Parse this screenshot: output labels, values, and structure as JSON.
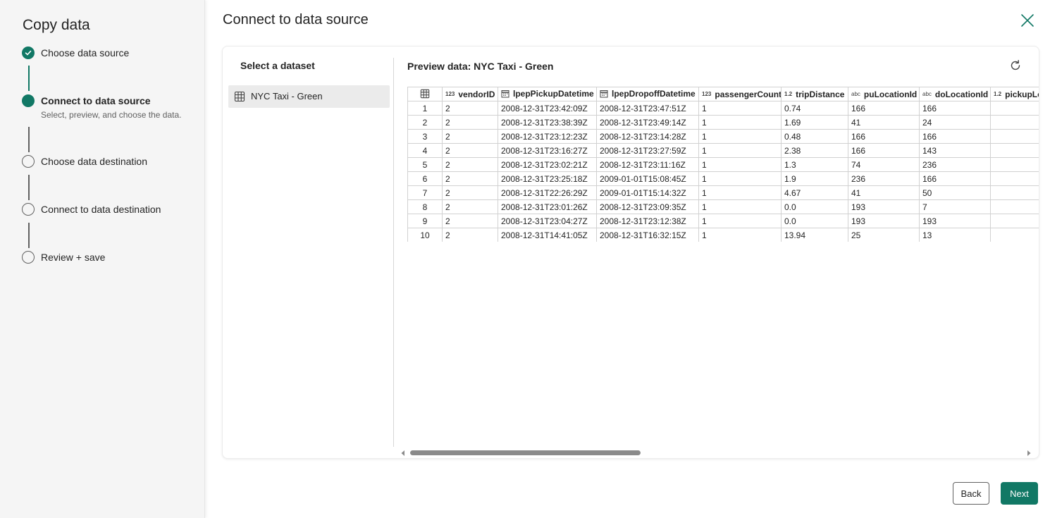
{
  "wizard": {
    "title": "Copy data",
    "steps": [
      {
        "label": "Choose data source",
        "sublabel": "",
        "state": "done"
      },
      {
        "label": "Connect to data source",
        "sublabel": "Select, preview, and choose the data.",
        "state": "current"
      },
      {
        "label": "Choose data destination",
        "sublabel": "",
        "state": "pending"
      },
      {
        "label": "Connect to data destination",
        "sublabel": "",
        "state": "pending"
      },
      {
        "label": "Review + save",
        "sublabel": "",
        "state": "pending"
      }
    ]
  },
  "page": {
    "title": "Connect to data source",
    "close_icon": "close-icon"
  },
  "dataset_panel": {
    "header": "Select a dataset",
    "items": [
      {
        "label": "NYC Taxi - Green",
        "icon": "table-grid-icon",
        "selected": true
      }
    ]
  },
  "preview": {
    "title": "Preview data: NYC Taxi - Green",
    "refresh_icon": "refresh-icon",
    "columns": [
      {
        "name": "",
        "type": "grid"
      },
      {
        "name": "vendorID",
        "type": "123"
      },
      {
        "name": "lpepPickupDatetime",
        "type": "datetime"
      },
      {
        "name": "lpepDropoffDatetime",
        "type": "datetime"
      },
      {
        "name": "passengerCount",
        "type": "123"
      },
      {
        "name": "tripDistance",
        "type": "1.2"
      },
      {
        "name": "puLocationId",
        "type": "abc"
      },
      {
        "name": "doLocationId",
        "type": "abc"
      },
      {
        "name": "pickupLo",
        "type": "1.2"
      }
    ],
    "rows": [
      [
        "1",
        "2",
        "2008-12-31T23:42:09Z",
        "2008-12-31T23:47:51Z",
        "1",
        "0.74",
        "166",
        "166",
        ""
      ],
      [
        "2",
        "2",
        "2008-12-31T23:38:39Z",
        "2008-12-31T23:49:14Z",
        "1",
        "1.69",
        "41",
        "24",
        ""
      ],
      [
        "3",
        "2",
        "2008-12-31T23:12:23Z",
        "2008-12-31T23:14:28Z",
        "1",
        "0.48",
        "166",
        "166",
        ""
      ],
      [
        "4",
        "2",
        "2008-12-31T23:16:27Z",
        "2008-12-31T23:27:59Z",
        "1",
        "2.38",
        "166",
        "143",
        ""
      ],
      [
        "5",
        "2",
        "2008-12-31T23:02:21Z",
        "2008-12-31T23:11:16Z",
        "1",
        "1.3",
        "74",
        "236",
        ""
      ],
      [
        "6",
        "2",
        "2008-12-31T23:25:18Z",
        "2009-01-01T15:08:45Z",
        "1",
        "1.9",
        "236",
        "166",
        ""
      ],
      [
        "7",
        "2",
        "2008-12-31T22:26:29Z",
        "2009-01-01T15:14:32Z",
        "1",
        "4.67",
        "41",
        "50",
        ""
      ],
      [
        "8",
        "2",
        "2008-12-31T23:01:26Z",
        "2008-12-31T23:09:35Z",
        "1",
        "0.0",
        "193",
        "7",
        ""
      ],
      [
        "9",
        "2",
        "2008-12-31T23:04:27Z",
        "2008-12-31T23:12:38Z",
        "1",
        "0.0",
        "193",
        "193",
        ""
      ],
      [
        "10",
        "2",
        "2008-12-31T14:41:05Z",
        "2008-12-31T16:32:15Z",
        "1",
        "13.94",
        "25",
        "13",
        ""
      ]
    ]
  },
  "footer": {
    "back_label": "Back",
    "next_label": "Next"
  },
  "colors": {
    "accent": "#117865",
    "sidebar_bg": "#f5f5f5",
    "selected_item_bg": "#ebebeb"
  }
}
